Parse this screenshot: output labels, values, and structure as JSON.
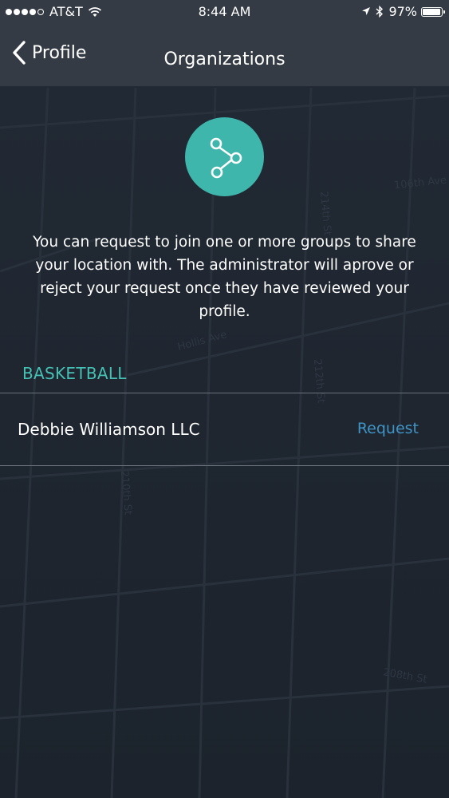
{
  "status_bar": {
    "carrier": "AT&T",
    "time": "8:44 AM",
    "battery_percent_label": "97%",
    "battery_level": 0.97
  },
  "nav": {
    "back_label": "Profile",
    "title": "Organizations"
  },
  "main": {
    "icon": "share-network-icon",
    "intro_text": "You can request to join one or more groups to share your location with. The administrator will aprove or reject your request once they have reviewed your profile.",
    "sections": [
      {
        "header": "BASKETBALL",
        "organizations": [
          {
            "name": "Debbie Williamson LLC",
            "action_label": "Request"
          }
        ]
      }
    ]
  },
  "map_labels": {
    "ave_106th": "106th Ave",
    "hollis_ave": "Hollis Ave",
    "st_214th": "214th St",
    "st_212th": "212th St",
    "st_210th": "210th St",
    "st_208th": "208th St"
  },
  "colors": {
    "accent_teal": "#45c0b4",
    "icon_circle": "#3fb6ac",
    "link_blue": "#3f94c6",
    "bar_background": "#353b44",
    "page_background": "#202832"
  }
}
